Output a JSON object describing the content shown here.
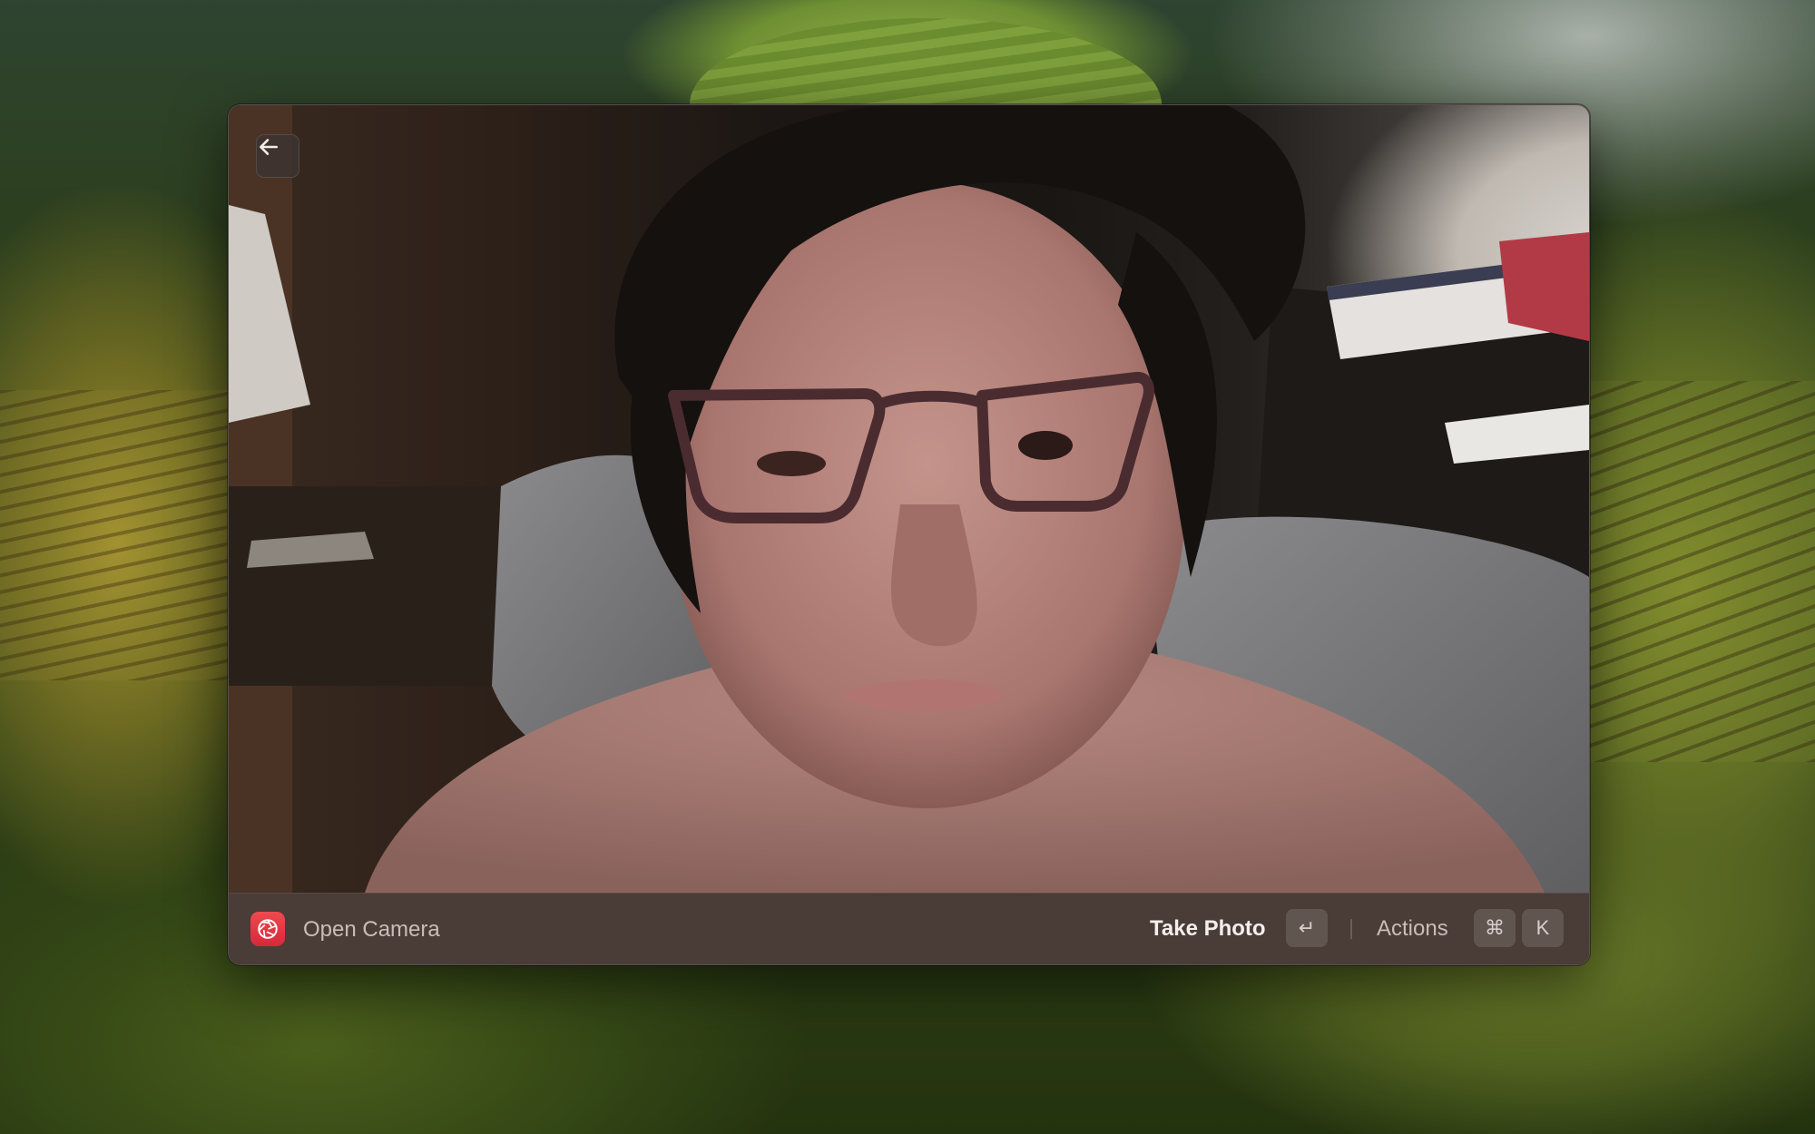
{
  "window": {
    "back_icon": "arrow-left-icon"
  },
  "camera": {
    "subject": "live camera preview"
  },
  "action_bar": {
    "app_icon": "camera-aperture-icon",
    "app_title": "Open Camera",
    "primary_action": "Take Photo",
    "primary_shortcut": "↵",
    "secondary_action": "Actions",
    "secondary_shortcut": [
      "⌘",
      "K"
    ]
  },
  "colors": {
    "app_icon_bg": "#e23a44",
    "action_bar_bg": "#4a3c37"
  }
}
